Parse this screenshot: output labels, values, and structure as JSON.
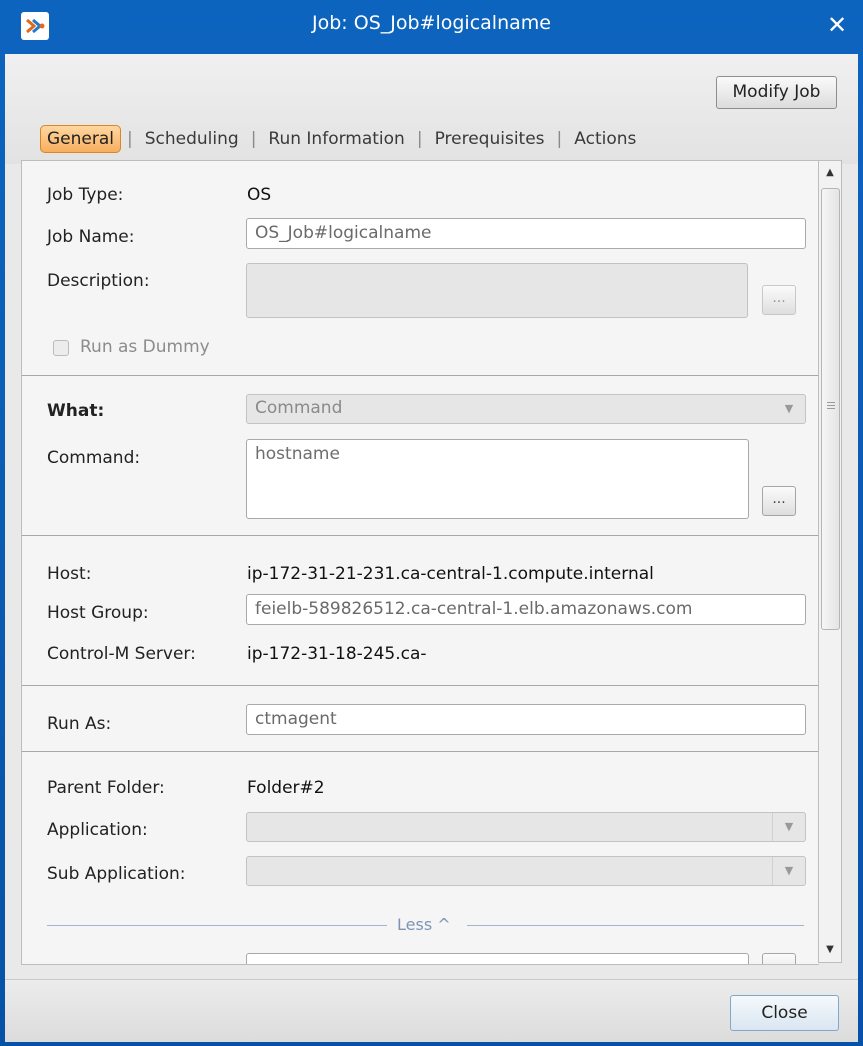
{
  "window": {
    "title": "Job: OS_Job#logicalname",
    "close_glyph": "✕"
  },
  "toolbar": {
    "modify_label": "Modify Job"
  },
  "tabs": [
    {
      "label": "General",
      "active": true
    },
    {
      "label": "Scheduling",
      "active": false
    },
    {
      "label": "Run Information",
      "active": false
    },
    {
      "label": "Prerequisites",
      "active": false
    },
    {
      "label": "Actions",
      "active": false
    }
  ],
  "tab_separator": "|",
  "general": {
    "job_type_label": "Job Type:",
    "job_type_value": "OS",
    "job_name_label": "Job Name:",
    "job_name_value": "OS_Job#logicalname",
    "description_label": "Description:",
    "description_value": "",
    "run_as_dummy_label": "Run as Dummy",
    "run_as_dummy_checked": false
  },
  "what": {
    "what_label": "What:",
    "what_value": "Command",
    "command_label": "Command:",
    "command_value": "hostname"
  },
  "host": {
    "host_label": "Host:",
    "host_value": "ip-172-31-21-231.ca-central-1.compute.internal",
    "host_group_label": "Host Group:",
    "host_group_value": "feielb-589826512.ca-central-1.elb.amazonaws.com",
    "server_label": "Control-M Server:",
    "server_value": "ip-172-31-18-245.ca-"
  },
  "run_as": {
    "label": "Run As:",
    "value": "ctmagent"
  },
  "folder": {
    "parent_label": "Parent Folder:",
    "parent_value": "Folder#2",
    "application_label": "Application:",
    "application_value": "",
    "sub_application_label": "Sub Application:",
    "sub_application_value": ""
  },
  "less_label": "Less ^",
  "ellipsis": "...",
  "footer": {
    "close_label": "Close"
  },
  "colors": {
    "titlebar": "#0d64be",
    "active_tab": "#f7ae5e",
    "panel_bg": "#f5f5f5"
  }
}
